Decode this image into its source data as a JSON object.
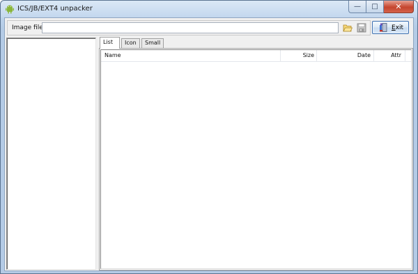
{
  "window": {
    "title": "ICS/JB/EXT4 unpacker",
    "caption_buttons": {
      "minimize": "—",
      "maximize": "□",
      "close": "✕"
    }
  },
  "toolbar": {
    "image_file_label": "Image file :",
    "image_file_value": "",
    "open_icon": "folder-open-icon",
    "save_icon": "save-icon",
    "exit_label_prefix": "E",
    "exit_label_suffix": "xit"
  },
  "tabs": [
    {
      "label": "List",
      "active": true
    },
    {
      "label": "Icon",
      "active": false
    },
    {
      "label": "Small",
      "active": false
    }
  ],
  "listview": {
    "columns": [
      "Name",
      "Size",
      "Date",
      "Attr"
    ],
    "rows": []
  },
  "colors": {
    "frame": "#b4cbe6",
    "client": "#f0f0f0",
    "close_button": "#c5452e"
  }
}
